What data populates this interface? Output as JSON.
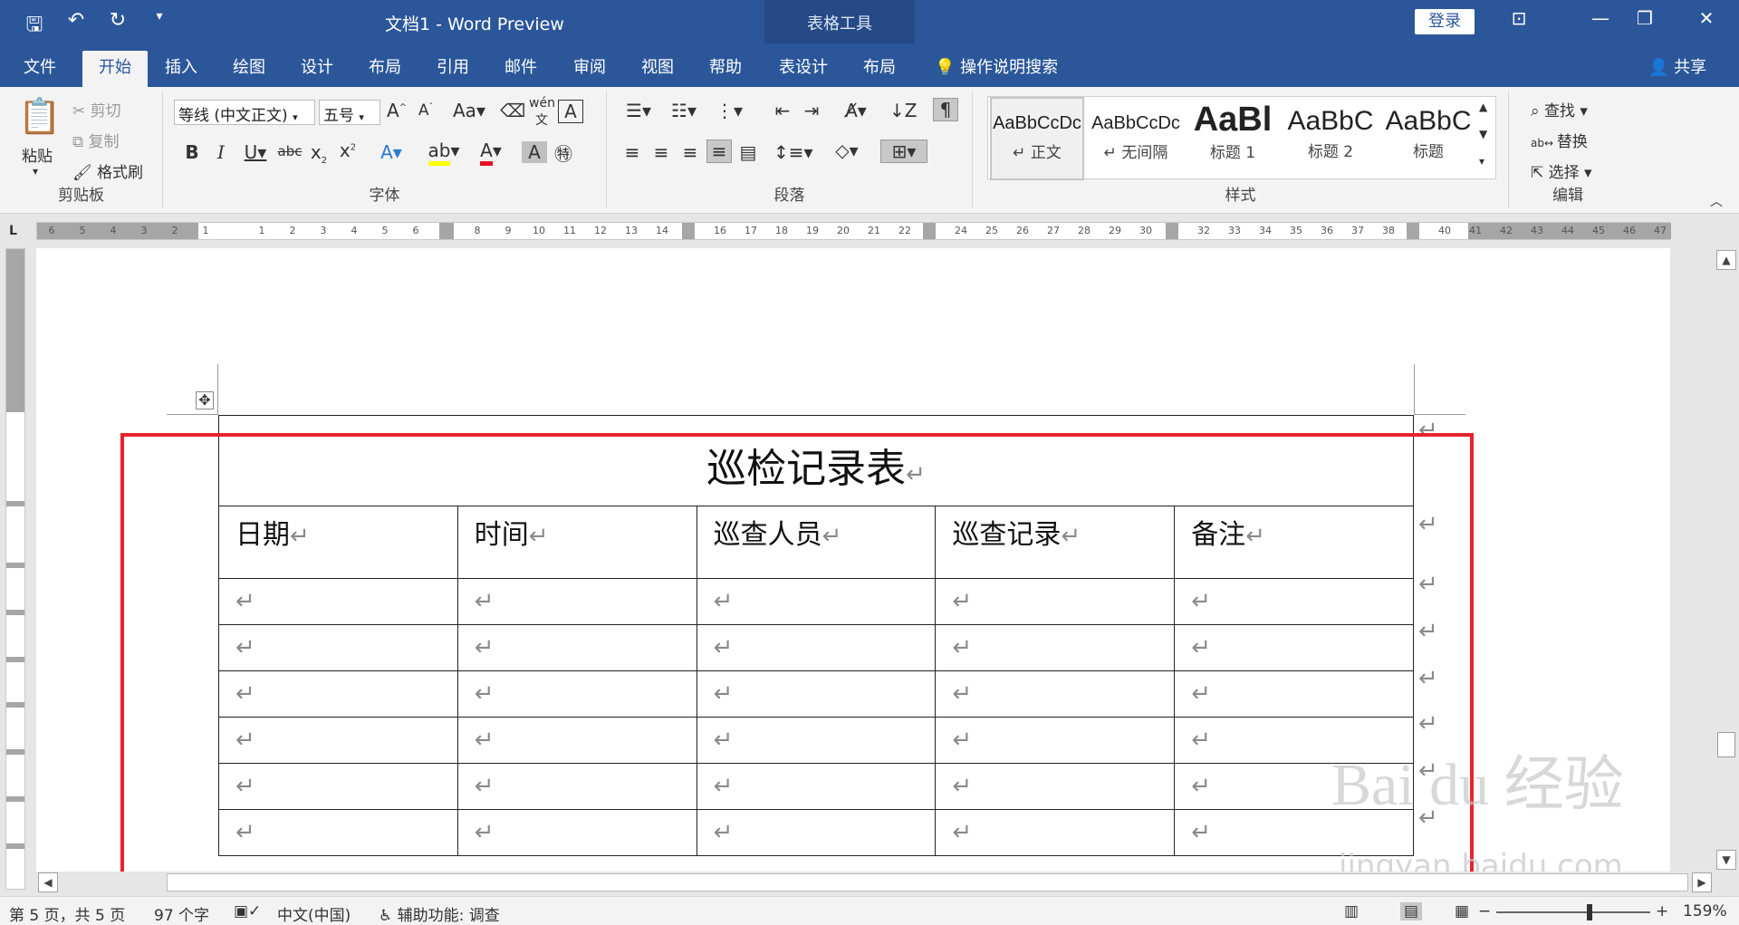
{
  "window": {
    "doc_title": "文档1  -  Word Preview",
    "context_title": "表格工具",
    "login": "登录",
    "qat": [
      "save-icon",
      "undo-icon",
      "redo-icon",
      "customize-icon"
    ]
  },
  "tabs": [
    {
      "label": "文件"
    },
    {
      "label": "开始"
    },
    {
      "label": "插入"
    },
    {
      "label": "绘图"
    },
    {
      "label": "设计"
    },
    {
      "label": "布局"
    },
    {
      "label": "引用"
    },
    {
      "label": "邮件"
    },
    {
      "label": "审阅"
    },
    {
      "label": "视图"
    },
    {
      "label": "帮助"
    },
    {
      "label": "表设计"
    },
    {
      "label": "布局"
    }
  ],
  "tell_me": "操作说明搜索",
  "share": "共享",
  "ribbon": {
    "clipboard": {
      "paste": "粘贴",
      "cut": "剪切",
      "copy": "复制",
      "format_painter": "格式刷",
      "label": "剪贴板"
    },
    "font": {
      "font_name": "等线 (中文正文)",
      "font_size": "五号",
      "label": "字体"
    },
    "paragraph": {
      "label": "段落"
    },
    "styles": {
      "label": "样式",
      "items": [
        {
          "sample": "AaBbCcDc",
          "name": "↵ 正文"
        },
        {
          "sample": "AaBbCcDc",
          "name": "↵ 无间隔"
        },
        {
          "sample": "AaBl",
          "name": "标题 1"
        },
        {
          "sample": "AaBbC",
          "name": "标题 2"
        },
        {
          "sample": "AaBbC",
          "name": "标题"
        }
      ]
    },
    "editing": {
      "find": "查找",
      "replace": "替换",
      "select": "选择",
      "label": "编辑"
    }
  },
  "ruler": {
    "left_nums": [
      "6",
      "5",
      "4",
      "3",
      "2",
      "1"
    ],
    "right_nums": [
      "1",
      "2",
      "3",
      "4",
      "5",
      "6",
      "8",
      "9",
      "10",
      "11",
      "12",
      "13",
      "14",
      "16",
      "17",
      "18",
      "19",
      "20",
      "21",
      "22",
      "24",
      "25",
      "26",
      "27",
      "28",
      "29",
      "30",
      "32",
      "33",
      "34",
      "35",
      "36",
      "37",
      "38",
      "40",
      "41",
      "42",
      "43",
      "44",
      "45",
      "46",
      "47"
    ]
  },
  "table": {
    "title": "巡检记录表",
    "headers": [
      "日期",
      "时间",
      "巡查人员",
      "巡查记录",
      "备注"
    ],
    "empty_rows": 6,
    "para_mark": "↵"
  },
  "watermark": {
    "main": "Bai du 经验",
    "sub": "jingyan.baidu.com"
  },
  "status": {
    "page": "第 5 页，共 5 页",
    "words": "97 个字",
    "language": "中文(中国)",
    "accessibility": "辅助功能: 调查",
    "zoom": "159%"
  },
  "colors": {
    "brand": "#2b579a",
    "highlight_frame": "#e8232b"
  }
}
